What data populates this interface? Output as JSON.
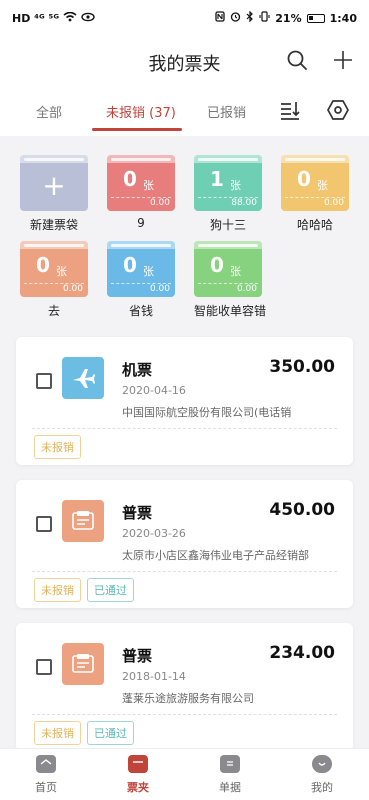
{
  "status_bar": {
    "left": "HD ⁴ᴳ ⁵ᴳ",
    "battery_percent": "21%",
    "time": "1:40"
  },
  "header": {
    "title": "我的票夹",
    "search_icon": "search-icon",
    "add_icon": "plus-icon"
  },
  "tabs": [
    {
      "label": "全部"
    },
    {
      "label": "未报销 (37)"
    },
    {
      "label": "已报销"
    }
  ],
  "tab_icons": [
    "sort-icon",
    "settings-hex-icon"
  ],
  "folders": [
    {
      "name": "新建票袋",
      "count": "",
      "unit": "",
      "amount": "",
      "color": "#b9bfd6",
      "plus": "+"
    },
    {
      "name": "9",
      "count": "0",
      "unit": "张",
      "amount": "0.00",
      "color": "#e87d7d"
    },
    {
      "name": "狗十三",
      "count": "1",
      "unit": "张",
      "amount": "88.00",
      "color": "#6fcfb4"
    },
    {
      "name": "哈哈哈",
      "count": "0",
      "unit": "张",
      "amount": "0.00",
      "color": "#f2c56f"
    },
    {
      "name": "去",
      "count": "0",
      "unit": "张",
      "amount": "0.00",
      "color": "#eca181"
    },
    {
      "name": "省钱",
      "count": "0",
      "unit": "张",
      "amount": "0.00",
      "color": "#6ab9e6"
    },
    {
      "name": "智能收单容错",
      "count": "0",
      "unit": "张",
      "amount": "0.00",
      "color": "#86d27e"
    }
  ],
  "cards": [
    {
      "type": "机票",
      "amount": "350.00",
      "date": "2020-04-16",
      "company": "中国国际航空股份有限公司(电话销",
      "badges": [
        "未报销"
      ],
      "icon": "airplane-icon",
      "icon_color": "#6bbde4"
    },
    {
      "type": "普票",
      "amount": "450.00",
      "date": "2020-03-26",
      "company": "太原市小店区鑫海伟业电子产品经销部",
      "badges": [
        "未报销",
        "已通过"
      ],
      "icon": "invoice-icon",
      "icon_color": "#eca181"
    },
    {
      "type": "普票",
      "amount": "234.00",
      "date": "2018-01-14",
      "company": "蓬莱乐途旅游服务有限公司",
      "badges": [
        "未报销",
        "已通过"
      ],
      "icon": "invoice-icon",
      "icon_color": "#eca181"
    }
  ],
  "bottom_nav": [
    {
      "label": "首页",
      "icon": "home-icon"
    },
    {
      "label": "票夹",
      "icon": "ticket-folder-icon"
    },
    {
      "label": "单据",
      "icon": "document-icon"
    },
    {
      "label": "我的",
      "icon": "profile-icon"
    }
  ],
  "colors": {
    "accent": "#c0443a"
  }
}
